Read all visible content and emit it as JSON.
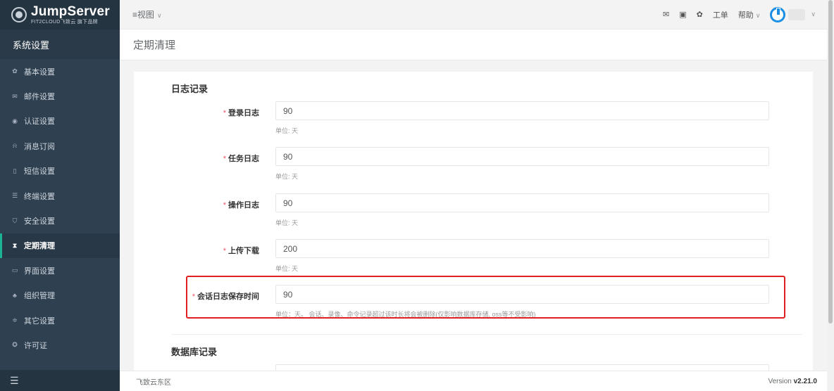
{
  "sidebar": {
    "logo_title": "JumpServer",
    "logo_subtitle": "FIT2CLOUD飞致云 旗下品牌",
    "section_title": "系统设置",
    "items": [
      {
        "label": "基本设置",
        "icon": "gear-icon",
        "glyph": "✿"
      },
      {
        "label": "邮件设置",
        "icon": "mail-icon",
        "glyph": "✉"
      },
      {
        "label": "认证设置",
        "icon": "user-circle-icon",
        "glyph": "◉"
      },
      {
        "label": "消息订阅",
        "icon": "bell-icon",
        "glyph": "⍾"
      },
      {
        "label": "短信设置",
        "icon": "mobile-icon",
        "glyph": "▯"
      },
      {
        "label": "终端设置",
        "icon": "terminal-icon",
        "glyph": "☰"
      },
      {
        "label": "安全设置",
        "icon": "shield-icon",
        "glyph": "⛉"
      },
      {
        "label": "定期清理",
        "icon": "hourglass-icon",
        "glyph": "⧗",
        "active": true
      },
      {
        "label": "界面设置",
        "icon": "laptop-icon",
        "glyph": "▭"
      },
      {
        "label": "组织管理",
        "icon": "sitemap-icon",
        "glyph": "♣"
      },
      {
        "label": "其它设置",
        "icon": "sliders-icon",
        "glyph": "≑"
      },
      {
        "label": "许可证",
        "icon": "license-icon",
        "glyph": "✪"
      }
    ],
    "collapse_icon": "menu-collapse-icon"
  },
  "topbar": {
    "view_label": "≡视图",
    "tickets_label": "工单",
    "help_label": "帮助",
    "icons": [
      "mail-icon",
      "web-terminal-icon",
      "settings-icon"
    ]
  },
  "page": {
    "title": "定期清理"
  },
  "form": {
    "section1_title": "日志记录",
    "section2_title": "数据库记录",
    "fields": [
      {
        "label": "登录日志",
        "value": "90",
        "help": "单位: 天"
      },
      {
        "label": "任务日志",
        "value": "90",
        "help": "单位: 天"
      },
      {
        "label": "操作日志",
        "value": "90",
        "help": "单位: 天"
      },
      {
        "label": "上传下载",
        "value": "200",
        "help": "单位: 天"
      },
      {
        "label": "会话日志保存时间",
        "value": "90",
        "help": "单位：天。 会话、录像、命令记录超过该时长将会被删除(仅影响数据库存储, oss等不受影响)"
      }
    ],
    "required_mark": "*"
  },
  "footer": {
    "company": "飞致云东区",
    "version_prefix": "Version ",
    "version": "v2.21.0"
  },
  "colors": {
    "sidebar_bg": "#2f4050",
    "accent": "#1ab394",
    "highlight_border": "#e02020",
    "required": "#ed5565"
  }
}
